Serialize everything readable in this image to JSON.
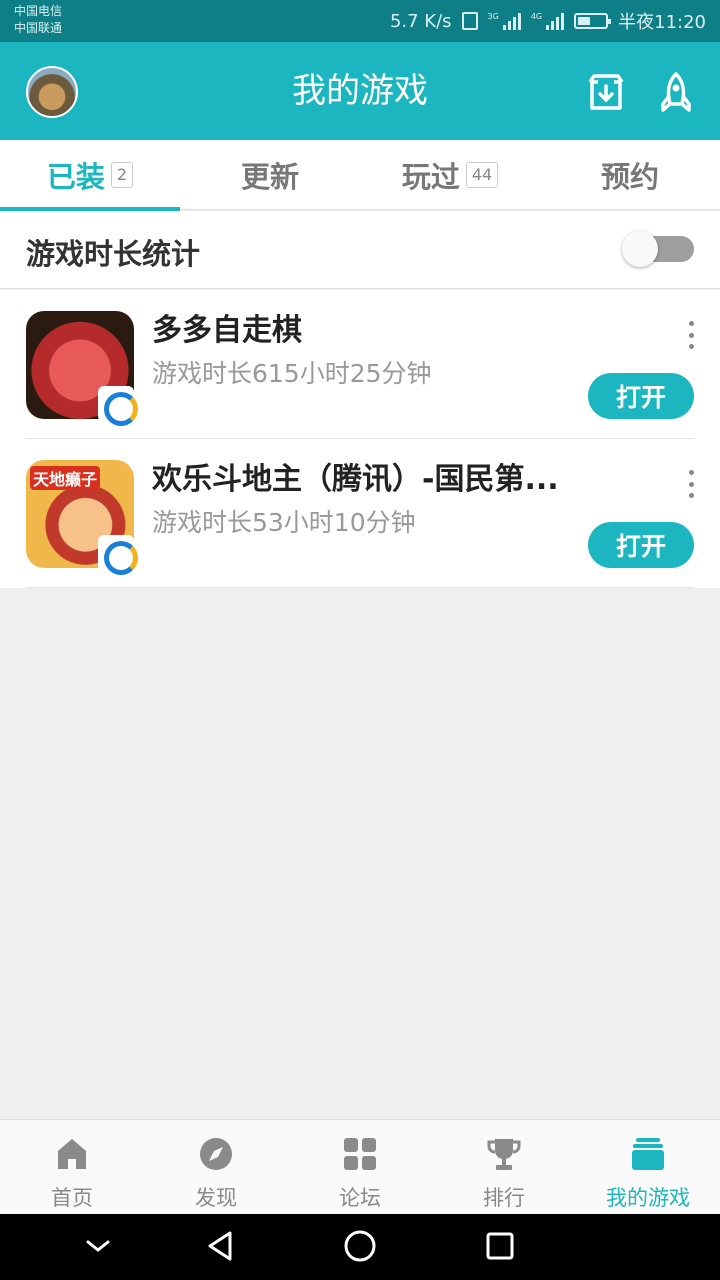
{
  "status_bar": {
    "carrier_1": "中国电信",
    "carrier_2": "中国联通",
    "speed": "5.7 K/s",
    "network_tag_1": "3G",
    "network_tag_2": "4G",
    "battery_level": 0.45,
    "time": "半夜11:20"
  },
  "header": {
    "title": "我的游戏",
    "icons": [
      "avatar",
      "download-icon",
      "rocket-icon"
    ]
  },
  "tabs": [
    {
      "label": "已装",
      "badge": "2",
      "active": true
    },
    {
      "label": "更新",
      "badge": ""
    },
    {
      "label": "玩过",
      "badge": "44"
    },
    {
      "label": "预约",
      "badge": ""
    }
  ],
  "stats": {
    "label": "游戏时长统计",
    "toggle_on": false
  },
  "games": [
    {
      "name": "多多自走棋",
      "playtime": "游戏时长615小时25分钟",
      "action": "打开",
      "icon": "game-icon-dota-chess"
    },
    {
      "name": "欢乐斗地主（腾讯）-国民第...",
      "playtime": "游戏时长53小时10分钟",
      "action": "打开",
      "icon": "game-icon-doudizhu",
      "icon_label": "天地癞子"
    }
  ],
  "bottom_nav": [
    {
      "label": "首页",
      "icon": "home-icon"
    },
    {
      "label": "发现",
      "icon": "compass-icon"
    },
    {
      "label": "论坛",
      "icon": "grid-icon"
    },
    {
      "label": "排行",
      "icon": "trophy-icon"
    },
    {
      "label": "我的游戏",
      "icon": "game-box-icon",
      "active": true
    }
  ],
  "colors": {
    "accent": "#1bb6c0",
    "status_bar": "#0f7f87",
    "background": "#efefef"
  }
}
